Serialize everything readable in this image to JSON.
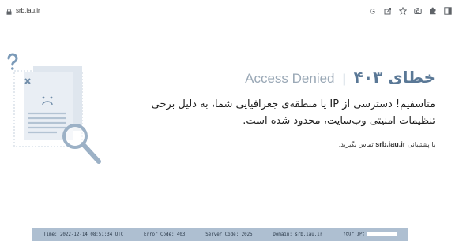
{
  "browser": {
    "url": "srb.iau.ir"
  },
  "error": {
    "title_fa": "خطای ۴۰۳",
    "separator": "|",
    "title_en": "Access Denied",
    "message": "متاسفیم! دسترسی از IP یا منطقه‌ی جغرافیایی شما، به دلیل برخی تنظیمات امنیتی وب‌سایت، محدود شده است.",
    "contact_prefix": "با پشتیبانی",
    "contact_domain": "srb.iau.ir",
    "contact_suffix": "تماس بگیرید."
  },
  "footer": {
    "time": "Time: 2022-12-14 08:51:34 UTC",
    "error_code": "Error Code: 403",
    "server_code": "Server Code: 2025",
    "domain": "Domain: srb.iau.ir",
    "ip_label": "Your IP:"
  },
  "colors": {
    "accent": "#5a7896",
    "footer_bg": "#aebfd1"
  },
  "icons": [
    "lock-icon",
    "google-icon",
    "share-icon",
    "star-icon",
    "camera-icon",
    "extensions-icon",
    "sidebar-icon",
    "document-illustration",
    "magnifier-icon",
    "question-mark-icon"
  ]
}
